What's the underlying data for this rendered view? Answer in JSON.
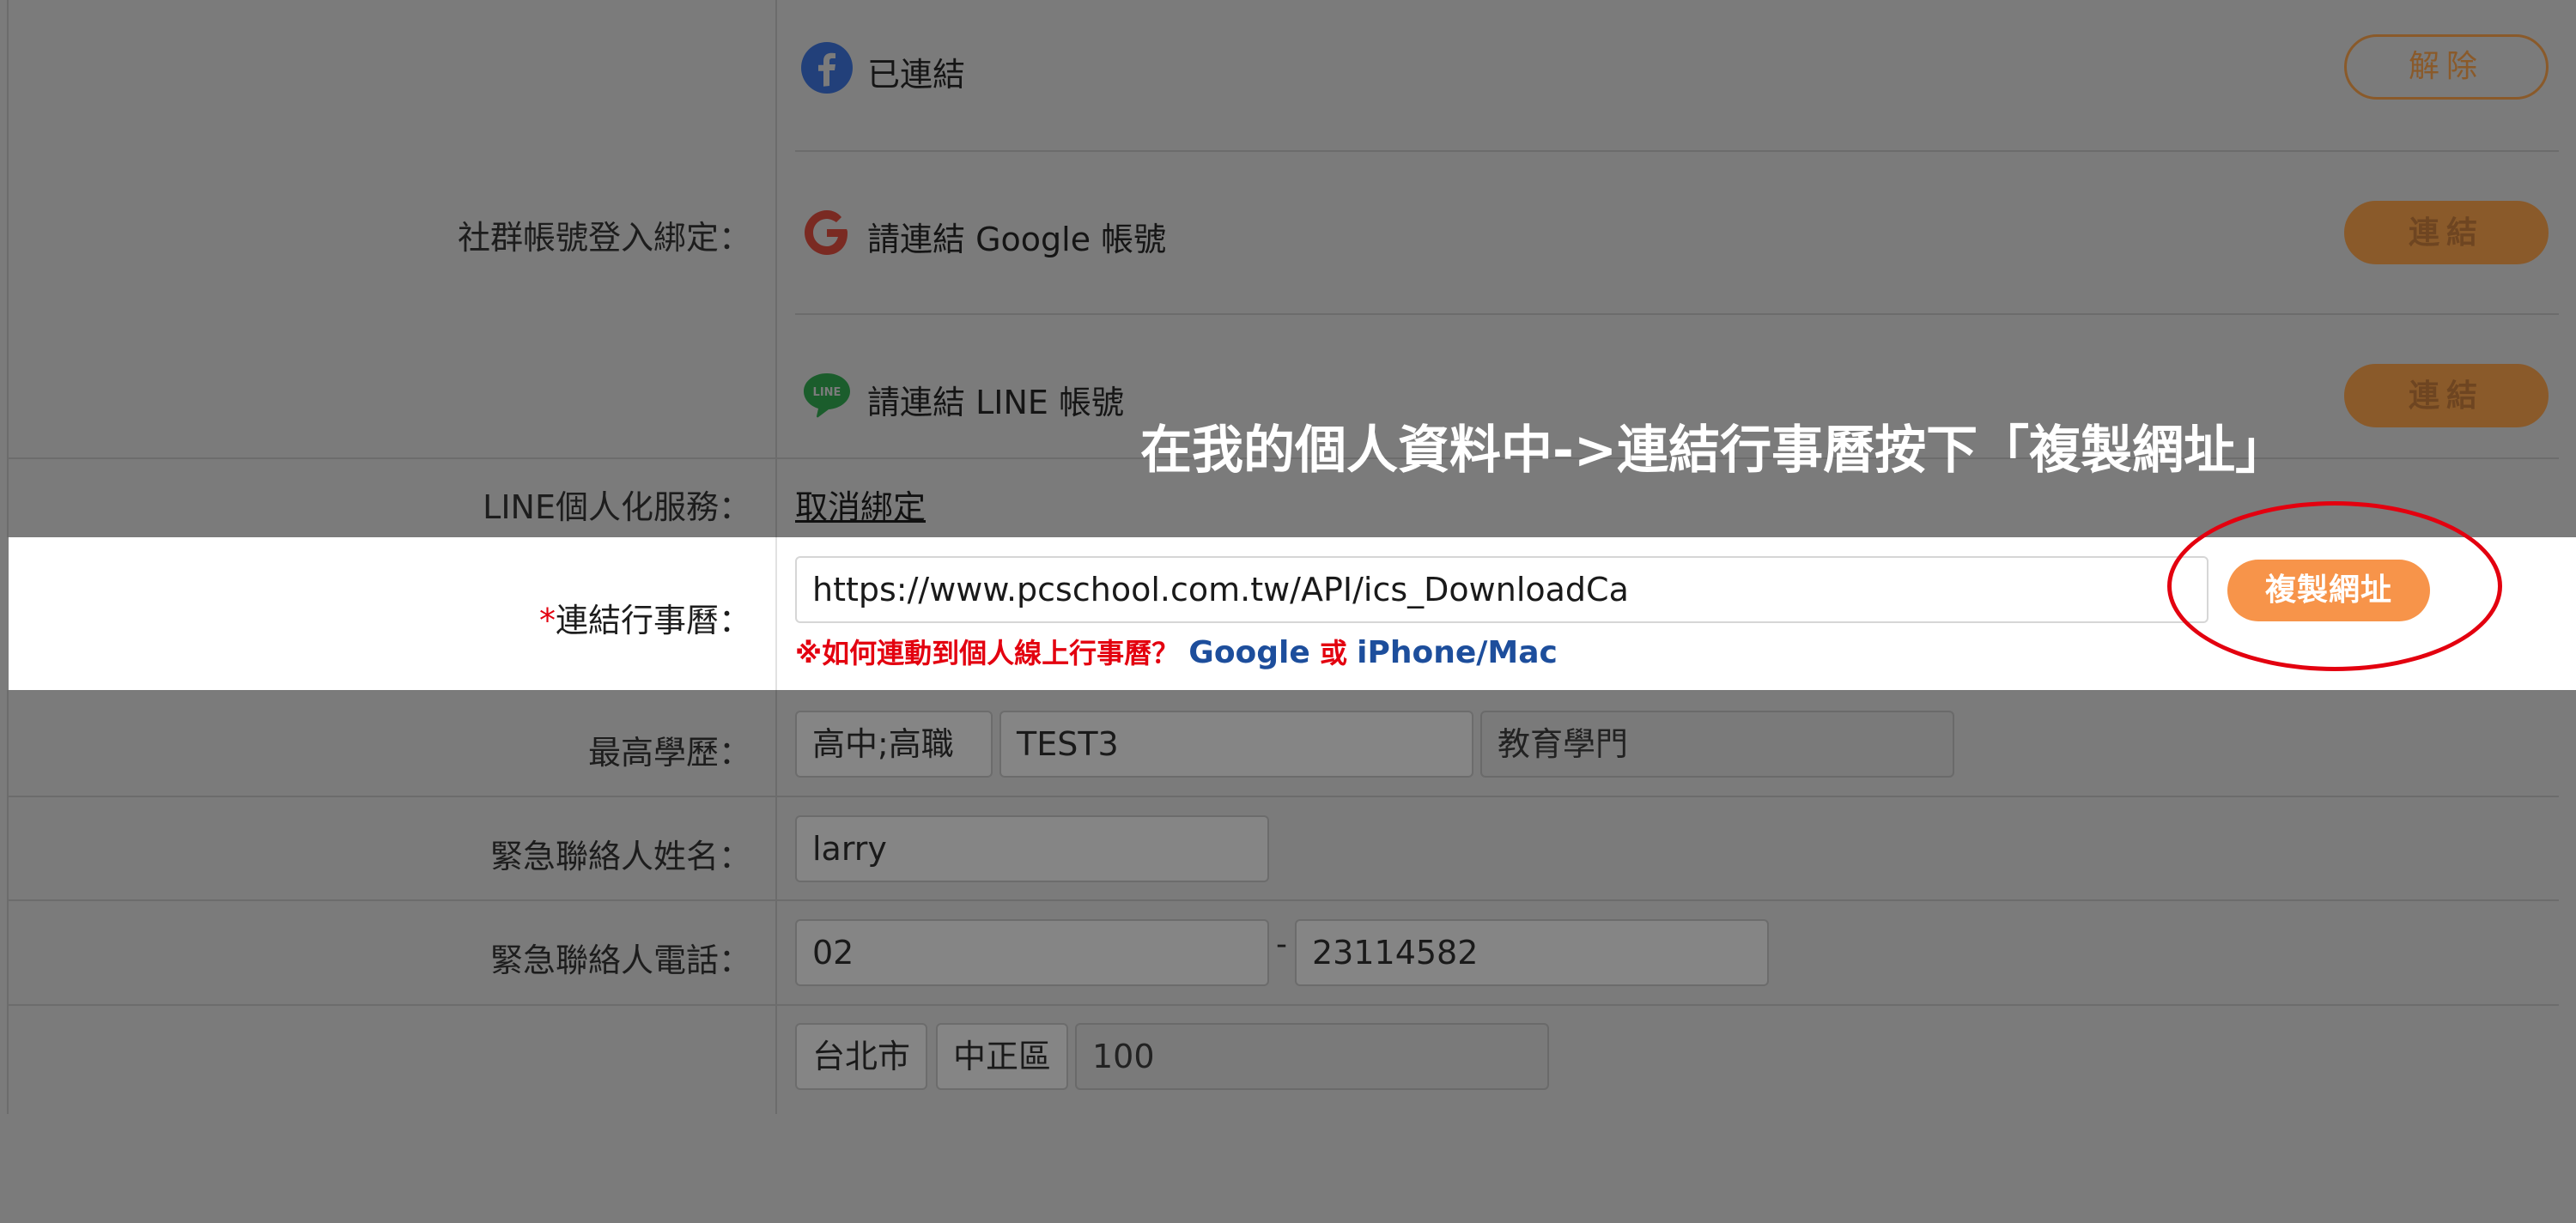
{
  "social_binding": {
    "label": "社群帳號登入綁定：",
    "facebook": {
      "text": "已連結",
      "button": "解除"
    },
    "google": {
      "text": "請連結 Google 帳號",
      "button": "連結"
    },
    "line": {
      "text": "請連結 LINE 帳號",
      "button": "連結"
    }
  },
  "line_service": {
    "label": "LINE個人化服務：",
    "link": "取消綁定"
  },
  "calendar": {
    "required_mark": "*",
    "label": "連結行事曆：",
    "url": "https://www.pcschool.com.tw/API/ics_DownloadCa",
    "copy_button": "複製網址",
    "help_prefix": "※如何連動到個人線上行事曆？",
    "help_google": "Google",
    "help_or": "或",
    "help_iphone": "iPhone/Mac"
  },
  "education": {
    "label": "最高學歷：",
    "level": "高中;高職",
    "school": "TEST3",
    "department": "教育學門"
  },
  "emergency_name": {
    "label": "緊急聯絡人姓名：",
    "value": "larry"
  },
  "emergency_phone": {
    "label": "緊急聯絡人電話：",
    "area": "02",
    "dash": "-",
    "number": "23114582"
  },
  "address": {
    "city": "台北市",
    "district": "中正區",
    "zip": "100"
  },
  "annotation": {
    "text": "在我的個人資料中->連結行事曆按下「複製網址」"
  },
  "colors": {
    "highlight": "#e3000f",
    "accent_orange": "#f7944a",
    "link_blue": "#1d4e9c"
  },
  "icons": [
    "facebook-icon",
    "google-icon",
    "line-icon"
  ]
}
